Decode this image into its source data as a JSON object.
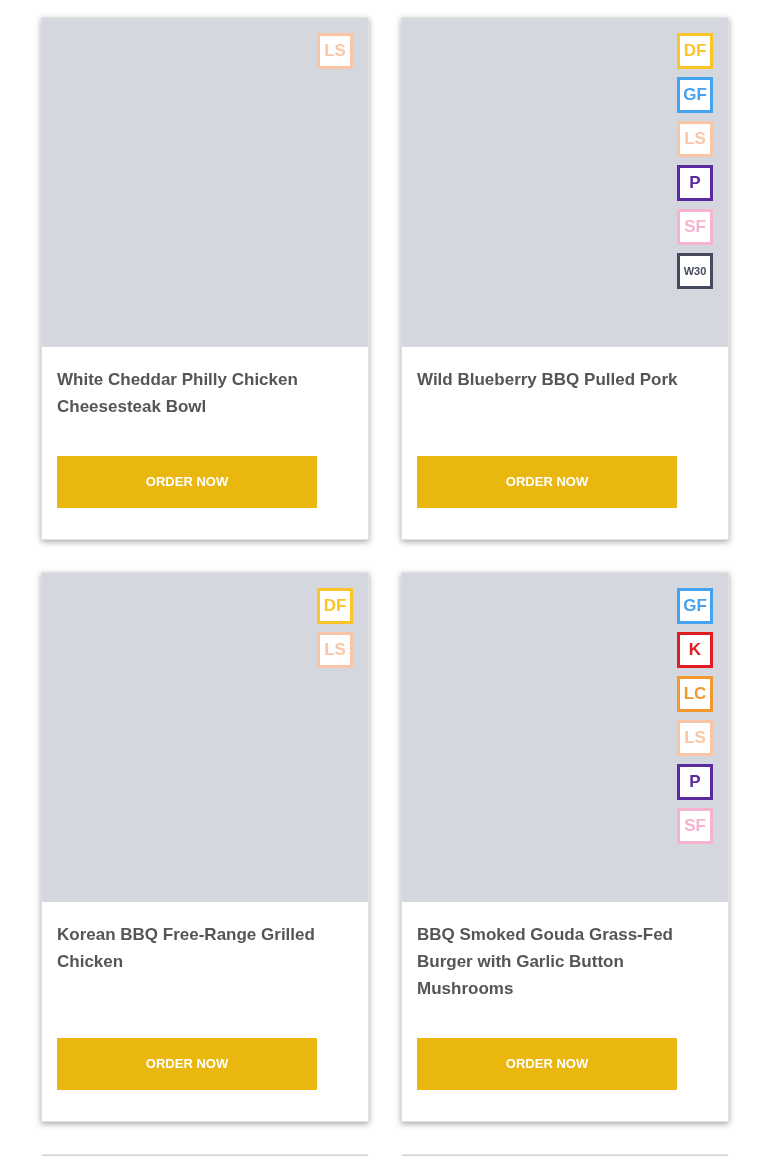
{
  "cards": [
    {
      "kind": "product",
      "title": "White Cheddar Philly Chicken Cheesesteak Bowl",
      "button": "ORDER NOW",
      "badges": [
        {
          "label": "LS",
          "color": "#f8c6a6"
        }
      ]
    },
    {
      "kind": "product",
      "title": "Wild Blueberry BBQ Pulled Pork",
      "button": "ORDER NOW",
      "badges": [
        {
          "label": "DF",
          "color": "#fbc52a"
        },
        {
          "label": "GF",
          "color": "#45a2ef"
        },
        {
          "label": "LS",
          "color": "#f8c6a6"
        },
        {
          "label": "P",
          "color": "#5a2a9e"
        },
        {
          "label": "SF",
          "color": "#f5b3cf"
        },
        {
          "label": "W30",
          "color": "#464a5e"
        }
      ]
    },
    {
      "kind": "product",
      "title": "Korean BBQ Free-Range Grilled Chicken",
      "button": "ORDER NOW",
      "badges": [
        {
          "label": "DF",
          "color": "#fbc52a"
        },
        {
          "label": "LS",
          "color": "#f8c6a6"
        }
      ]
    },
    {
      "kind": "product",
      "title": "BBQ Smoked Gouda Grass-Fed Burger with Garlic Button Mushrooms",
      "button": "ORDER NOW",
      "badges": [
        {
          "label": "GF",
          "color": "#45a2ef"
        },
        {
          "label": "K",
          "color": "#e11b22"
        },
        {
          "label": "LC",
          "color": "#f3982c"
        },
        {
          "label": "LS",
          "color": "#f8c6a6"
        },
        {
          "label": "P",
          "color": "#5a2a9e"
        },
        {
          "label": "SF",
          "color": "#f5b3cf"
        }
      ]
    },
    {
      "kind": "cut_off"
    },
    {
      "kind": "cut_off"
    }
  ]
}
